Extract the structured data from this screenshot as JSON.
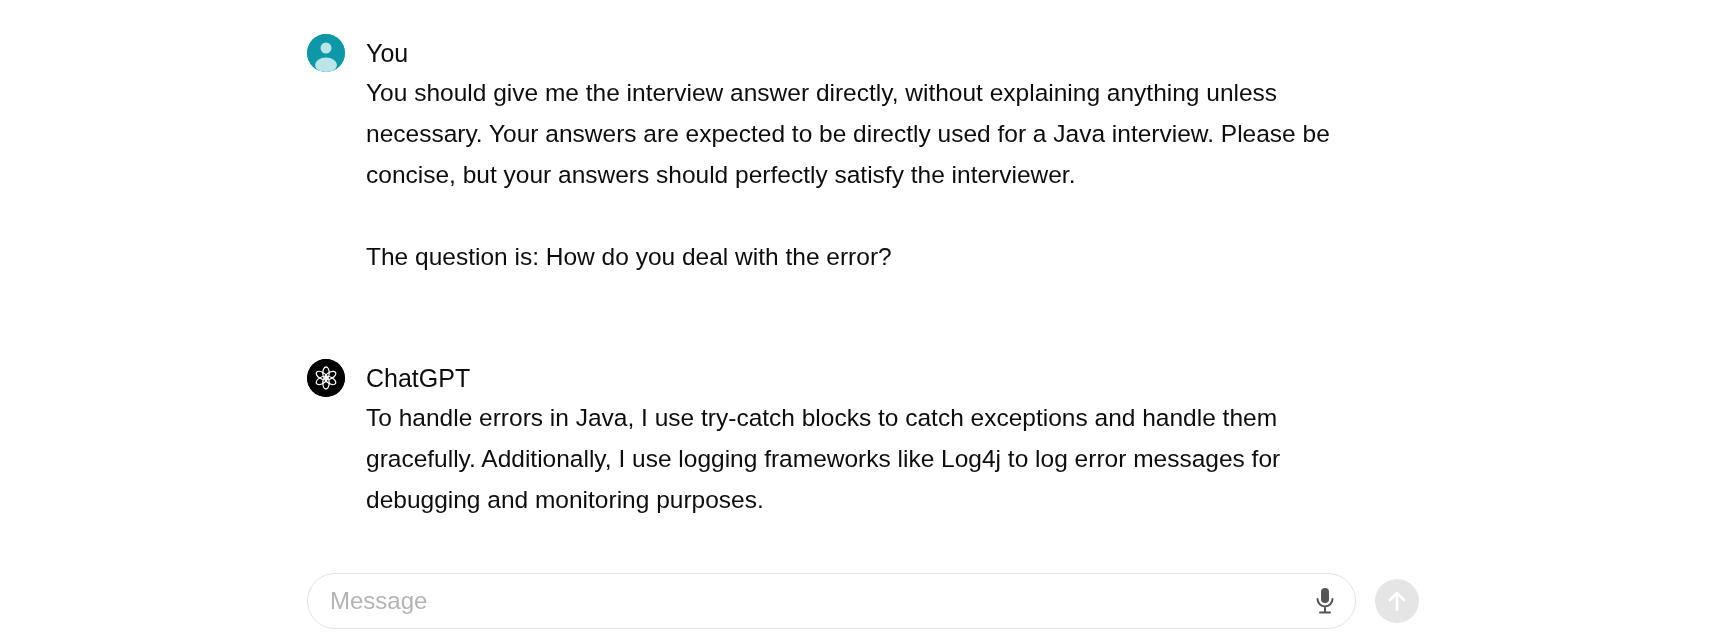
{
  "messages": [
    {
      "author": "You",
      "kind": "user",
      "paragraphs": [
        "You should give me the interview answer directly, without explaining anything unless necessary. Your answers are expected to be directly used for a Java interview. Please be concise, but your answers should perfectly satisfy the interviewer.",
        "The question is: How do you deal with the error?"
      ]
    },
    {
      "author": "ChatGPT",
      "kind": "assistant",
      "paragraphs": [
        "To handle errors in Java, I use try-catch blocks to catch exceptions and handle them gracefully. Additionally, I use logging frameworks like Log4j to log error messages for debugging and monitoring purposes."
      ]
    }
  ],
  "composer": {
    "placeholder": "Message",
    "send_disabled": true
  }
}
